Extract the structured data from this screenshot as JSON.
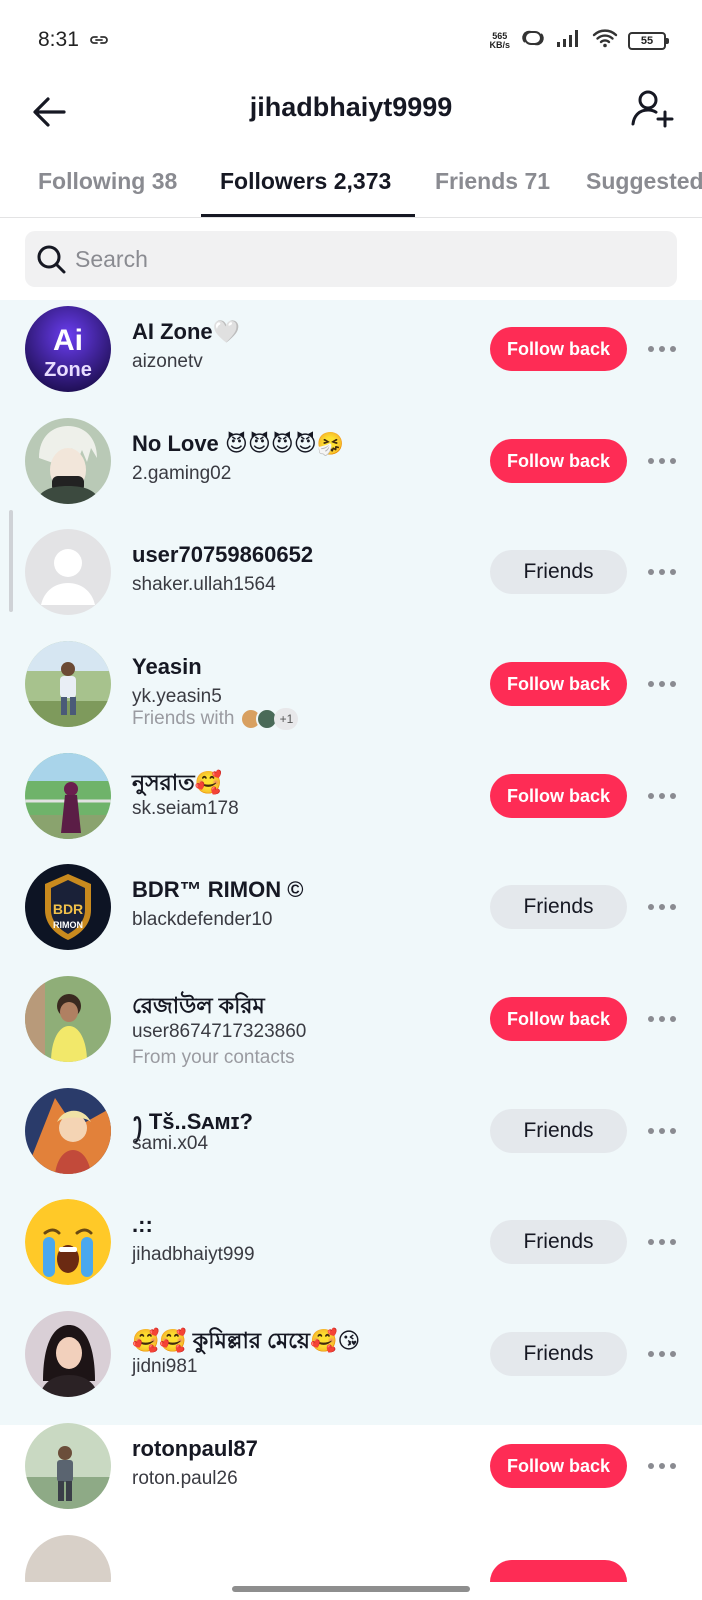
{
  "status_bar": {
    "time": "8:31",
    "net_speed_value": "565",
    "net_speed_unit": "KB/s",
    "battery": "55"
  },
  "header": {
    "title": "jihadbhaiyt9999"
  },
  "tabs": [
    {
      "label": "Following 38"
    },
    {
      "label": "Followers 2,373"
    },
    {
      "label": "Friends 71"
    },
    {
      "label": "Suggested"
    }
  ],
  "search": {
    "placeholder": "Search"
  },
  "colors": {
    "accent": "#fe2c55",
    "highlight_bg": "#f0f8fa",
    "friends_btn_bg": "#e4e8ec"
  },
  "followers": [
    {
      "name": "AI Zone🤍",
      "username": "aizonetv",
      "button": "Follow back"
    },
    {
      "name": "No Love 😈😈😈😈🤧",
      "username": "2.gaming02",
      "button": "Follow back"
    },
    {
      "name": "user70759860652",
      "username": "shaker.ullah1564",
      "button": "Friends"
    },
    {
      "name": "Yeasin",
      "username": "yk.yeasin5",
      "extra": "Friends with",
      "extra_count": "+1",
      "button": "Follow back"
    },
    {
      "name": "নুসরাত🥰",
      "username": "sk.seiam178",
      "button": "Follow back"
    },
    {
      "name": "BDR™ RIMON ©",
      "username": "blackdefender10",
      "button": "Friends"
    },
    {
      "name": "রেজাউল করিম",
      "username": "user8674717323860",
      "extra": "From your contacts",
      "button": "Follow back"
    },
    {
      "name": "ꫂ Tš..Sᴀᴍɪ?",
      "username": "sami.x04",
      "button": "Friends"
    },
    {
      "name": ".::",
      "username": "jihadbhaiyt999",
      "button": "Friends"
    },
    {
      "name": "🥰🥰 কুমিল্লার মেয়ে🥰😘",
      "username": "jidni981",
      "button": "Friends"
    },
    {
      "name": "rotonpaul87",
      "username": "roton.paul26",
      "button": "Follow back"
    }
  ]
}
